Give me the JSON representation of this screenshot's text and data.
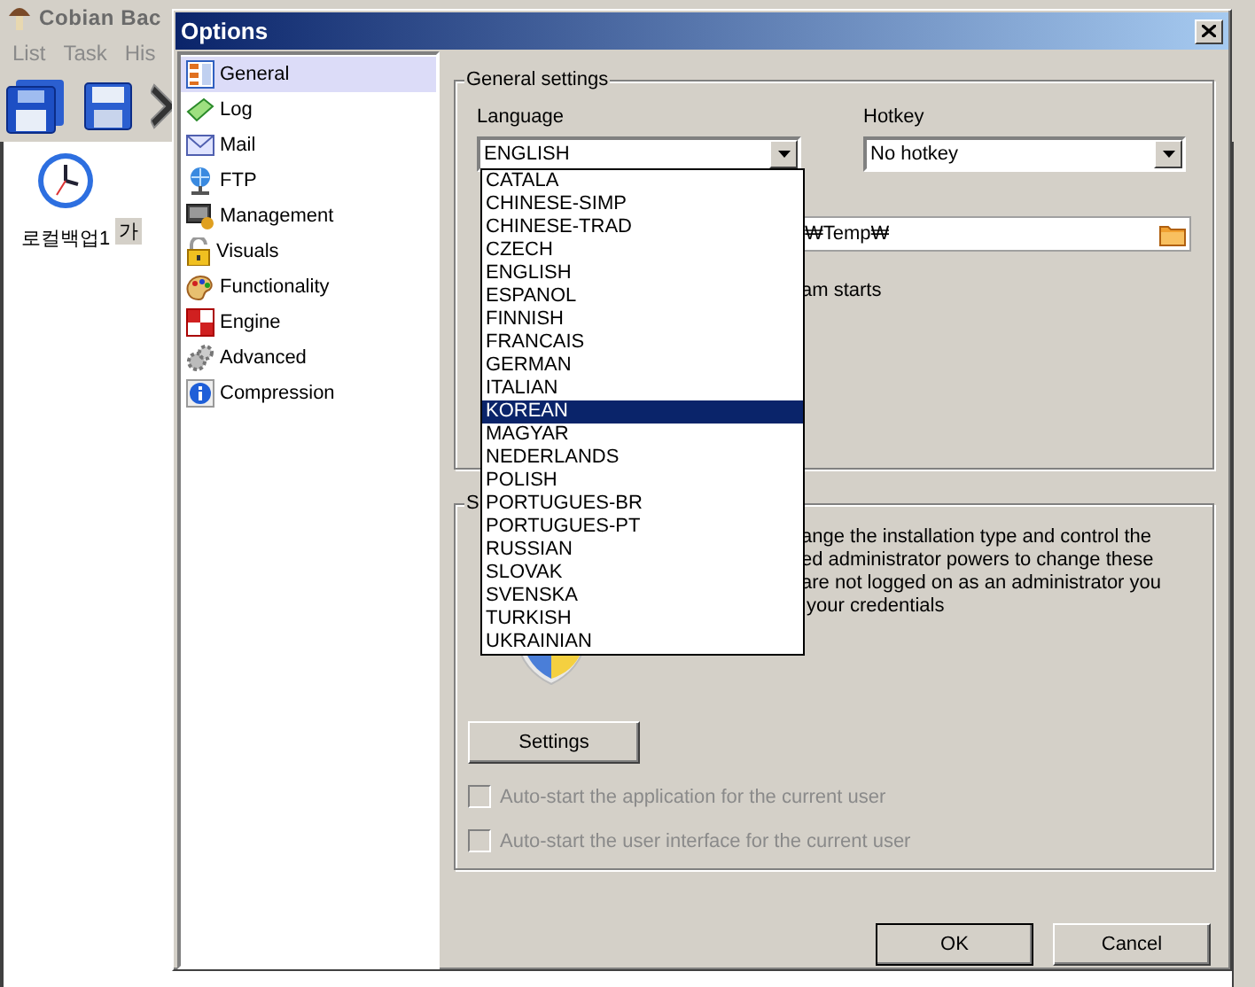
{
  "background_window": {
    "title": "Cobian Bac",
    "menu": [
      "List",
      "Task",
      "His"
    ],
    "task": {
      "name": "로컬백업1",
      "column_2": "가"
    }
  },
  "dialog": {
    "title": "Options",
    "nav": [
      {
        "label": "General",
        "selected": true
      },
      {
        "label": "Log",
        "selected": false
      },
      {
        "label": "Mail",
        "selected": false
      },
      {
        "label": "FTP",
        "selected": false
      },
      {
        "label": "Management",
        "selected": false
      },
      {
        "label": "Visuals",
        "selected": false
      },
      {
        "label": "Functionality",
        "selected": false
      },
      {
        "label": "Engine",
        "selected": false
      },
      {
        "label": "Advanced",
        "selected": false
      },
      {
        "label": "Compression",
        "selected": false
      }
    ],
    "general_settings": {
      "title": "General settings",
      "language": {
        "label": "Language",
        "value": "ENGLISH"
      },
      "hotkey": {
        "label": "Hotkey",
        "value": "No hotkey"
      },
      "path_field": {
        "value": "₩Temp₩"
      },
      "partial_text": "am starts"
    },
    "language_list": [
      {
        "label": "CATALA",
        "selected": false
      },
      {
        "label": "CHINESE-SIMP",
        "selected": false
      },
      {
        "label": "CHINESE-TRAD",
        "selected": false
      },
      {
        "label": "CZECH",
        "selected": false
      },
      {
        "label": "ENGLISH",
        "selected": false
      },
      {
        "label": "ESPANOL",
        "selected": false
      },
      {
        "label": "FINNISH",
        "selected": false
      },
      {
        "label": "FRANCAIS",
        "selected": false
      },
      {
        "label": "GERMAN",
        "selected": false
      },
      {
        "label": "ITALIAN",
        "selected": false
      },
      {
        "label": "KOREAN",
        "selected": true
      },
      {
        "label": "MAGYAR",
        "selected": false
      },
      {
        "label": "NEDERLANDS",
        "selected": false
      },
      {
        "label": "POLISH",
        "selected": false
      },
      {
        "label": "PORTUGUES-BR",
        "selected": false
      },
      {
        "label": "PORTUGUES-PT",
        "selected": false
      },
      {
        "label": "RUSSIAN",
        "selected": false
      },
      {
        "label": "SLOVAK",
        "selected": false
      },
      {
        "label": "SVENSKA",
        "selected": false
      },
      {
        "label": "TURKISH",
        "selected": false
      },
      {
        "label": "UKRAINIAN",
        "selected": false
      }
    ],
    "service_group": {
      "title": "S",
      "text_lines": [
        "ange the installation type and control the",
        "ed administrator powers to change these",
        "are not logged on as an administrator you",
        " your credentials"
      ],
      "settings_button": "Settings",
      "checkboxes": [
        {
          "label": "Auto-start the application for the current user",
          "checked": false,
          "disabled": true
        },
        {
          "label": "Auto-start the user interface for the current user",
          "checked": false,
          "disabled": true
        }
      ]
    },
    "buttons": [
      {
        "label": "OK",
        "default": true
      },
      {
        "label": "Cancel",
        "default": false
      }
    ]
  }
}
